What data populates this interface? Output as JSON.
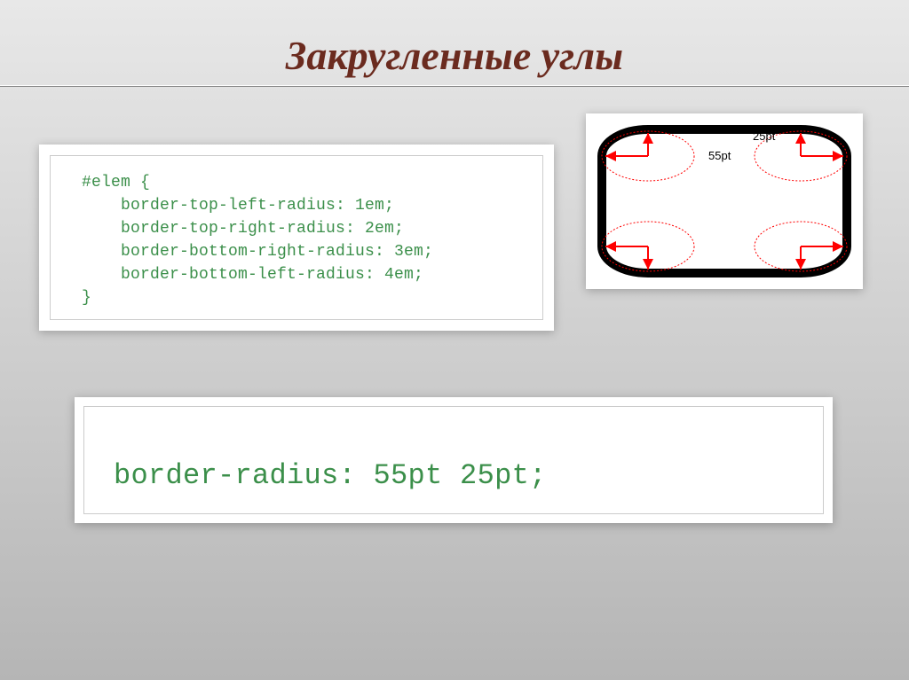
{
  "title": "Закругленные углы",
  "code1": "#elem {\n    border-top-left-radius: 1em;\n    border-top-right-radius: 2em;\n    border-bottom-right-radius: 3em;\n    border-bottom-left-radius: 4em;\n}",
  "code2": "border-radius: 55pt 25pt;",
  "diagram": {
    "label_v": "25pt",
    "label_h": "55pt"
  }
}
